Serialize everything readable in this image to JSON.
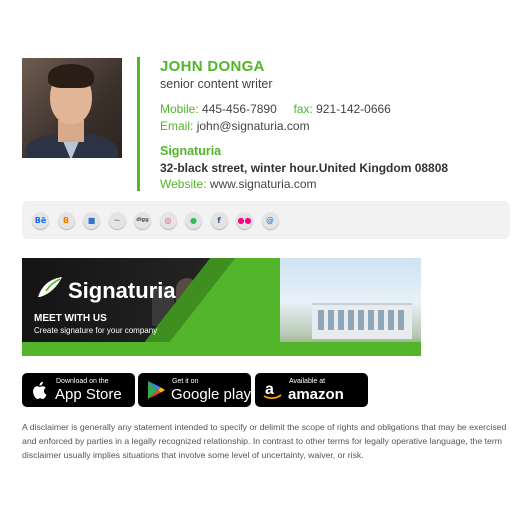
{
  "contact": {
    "name": "JOHN DONGA",
    "title": "senior content writer",
    "mobile_label": "Mobile:",
    "mobile": "445-456-7890",
    "fax_label": "fax:",
    "fax": "921-142-0666",
    "email_label": "Email:",
    "email": "john@signaturia.com",
    "company": "Signaturia",
    "address": "32-black street, winter hour.United Kingdom 08808",
    "website_label": "Website:",
    "website": "www.signaturia.com"
  },
  "social": [
    {
      "icon": "behance-icon",
      "glyph": "Bē",
      "color": "#1769ff"
    },
    {
      "icon": "blogger-icon",
      "glyph": "B",
      "color": "#f57d00"
    },
    {
      "icon": "delicious-icon",
      "glyph": "■",
      "color": "#3274d1"
    },
    {
      "icon": "deviantart-icon",
      "glyph": "~",
      "color": "#7a8a7f"
    },
    {
      "icon": "digg-icon",
      "glyph": "digg",
      "color": "#555555"
    },
    {
      "icon": "dribbble-icon",
      "glyph": "◎",
      "color": "#ea4c89"
    },
    {
      "icon": "evernote-icon",
      "glyph": "●",
      "color": "#2dbe60"
    },
    {
      "icon": "facebook-icon",
      "glyph": "f",
      "color": "#3b5998"
    },
    {
      "icon": "flickr-icon",
      "glyph": "●●",
      "color": "#ff0084"
    },
    {
      "icon": "email-icon",
      "glyph": "@",
      "color": "#3b8fd9"
    }
  ],
  "banner": {
    "brand": "Signaturia",
    "headline": "MEET WITH US",
    "tagline": "Create signature for your company",
    "accent": "#52b52a"
  },
  "stores": [
    {
      "small": "Download on the",
      "big": "App Store",
      "icon": "apple-icon"
    },
    {
      "small": "Get it on",
      "big": "Google play",
      "icon": "google-play-icon"
    },
    {
      "small": "Available at",
      "big": "amazon",
      "icon": "amazon-icon"
    }
  ],
  "disclaimer": "A disclaimer is generally any statement intended to specify or delimit the scope of rights and obligations that may be exercised and enforced by parties in a legally recognized relationship. In contrast to other terms for legally operative language, the term disclaimer usually implies situations that involve some level of uncertainty, waiver, or risk."
}
